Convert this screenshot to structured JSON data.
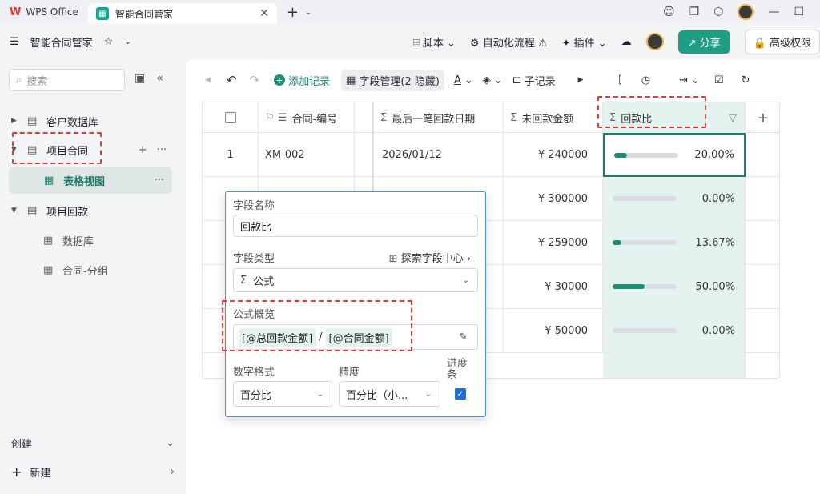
{
  "titlebar": {
    "app_tab": "WPS Office",
    "active_tab": "智能合同管家"
  },
  "appbar": {
    "title": "智能合同管家",
    "script": "脚本",
    "automation": "自动化流程",
    "plugins": "插件",
    "share": "分享",
    "advanced": "高级权限"
  },
  "sidebar": {
    "search_placeholder": "搜索",
    "items": [
      {
        "label": "客户数据库"
      },
      {
        "label": "项目合同"
      },
      {
        "label": "表格视图"
      },
      {
        "label": "项目回款"
      },
      {
        "label": "数据库"
      },
      {
        "label": "合同-分组"
      }
    ],
    "create_label": "创建",
    "new_label": "新建"
  },
  "toolbar": {
    "add_record": "添加记录",
    "field_manage": "字段管理(2 隐藏)",
    "sub_record": "子记录"
  },
  "table": {
    "headers": {
      "contract_no": "合同-编号",
      "last_date": "最后一笔回款日期",
      "unpaid": "未回款金额",
      "ratio": "回款比"
    },
    "rows": [
      {
        "index": "1",
        "contract_no": "XM-002",
        "last_date": "2026/01/12",
        "unpaid": "¥ 240000",
        "ratio_text": "20.00%",
        "ratio": 0.2
      },
      {
        "index": "",
        "contract_no": "",
        "last_date": "",
        "unpaid": "¥ 300000",
        "ratio_text": "0.00%",
        "ratio": 0.0
      },
      {
        "index": "",
        "contract_no": "",
        "last_date": "",
        "unpaid": "¥ 259000",
        "ratio_text": "13.67%",
        "ratio": 0.1367
      },
      {
        "index": "",
        "contract_no": "",
        "last_date": "",
        "unpaid": "¥ 30000",
        "ratio_text": "50.00%",
        "ratio": 0.5
      },
      {
        "index": "",
        "contract_no": "",
        "last_date": "",
        "unpaid": "¥ 50000",
        "ratio_text": "0.00%",
        "ratio": 0.0
      }
    ]
  },
  "popup": {
    "field_name_label": "字段名称",
    "field_name_value": "回款比",
    "field_type_label": "字段类型",
    "explore_link": "探索字段中心",
    "field_type_value": "公式",
    "formula_label": "公式概览",
    "formula_part1": "[@总回款金额]",
    "formula_sep": "/",
    "formula_part2": "[@合同金额]",
    "number_format_label": "数字格式",
    "number_format_value": "百分比",
    "precision_label": "精度",
    "precision_value": "百分比（小...",
    "progress_label": "进度条"
  },
  "colors": {
    "accent": "#1a8f75",
    "annotation": "#e03a3a",
    "popup_border": "#4a90d9"
  }
}
